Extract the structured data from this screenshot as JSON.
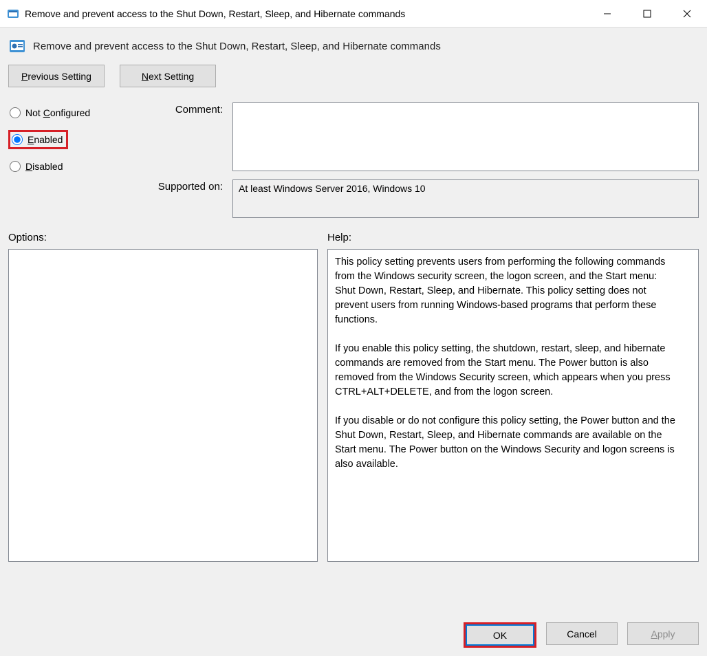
{
  "window": {
    "title": "Remove and prevent access to the Shut Down, Restart, Sleep, and Hibernate commands"
  },
  "header": {
    "title": "Remove and prevent access to the Shut Down, Restart, Sleep, and Hibernate commands"
  },
  "nav": {
    "previous_label_pre": "P",
    "previous_label_post": "revious Setting",
    "next_label_pre": "N",
    "next_label_post": "ext Setting"
  },
  "radios": {
    "not_configured_pre": "Not ",
    "not_configured_ul": "C",
    "not_configured_post": "onfigured",
    "enabled_ul": "E",
    "enabled_post": "nabled",
    "disabled_ul": "D",
    "disabled_post": "isabled",
    "selected": "enabled"
  },
  "labels": {
    "comment": "Comment:",
    "supported": "Supported on:",
    "options": "Options:",
    "help": "Help:"
  },
  "fields": {
    "comment_value": "",
    "supported_value": "At least Windows Server 2016, Windows 10"
  },
  "help_text": "This policy setting prevents users from performing the following commands from the Windows security screen, the logon screen, and the Start menu: Shut Down, Restart, Sleep, and Hibernate. This policy setting does not prevent users from running Windows-based programs that perform these functions.\n\nIf you enable this policy setting, the shutdown, restart, sleep, and hibernate commands are removed from the Start menu. The Power button is also removed from the Windows Security screen, which appears when you press CTRL+ALT+DELETE, and from the logon screen.\n\nIf you disable or do not configure this policy setting, the Power button and the Shut Down, Restart, Sleep, and Hibernate commands are available on the Start menu. The Power button on the Windows Security and logon screens is also available.",
  "buttons": {
    "ok": "OK",
    "cancel": "Cancel",
    "apply_ul": "A",
    "apply_post": "pply"
  }
}
